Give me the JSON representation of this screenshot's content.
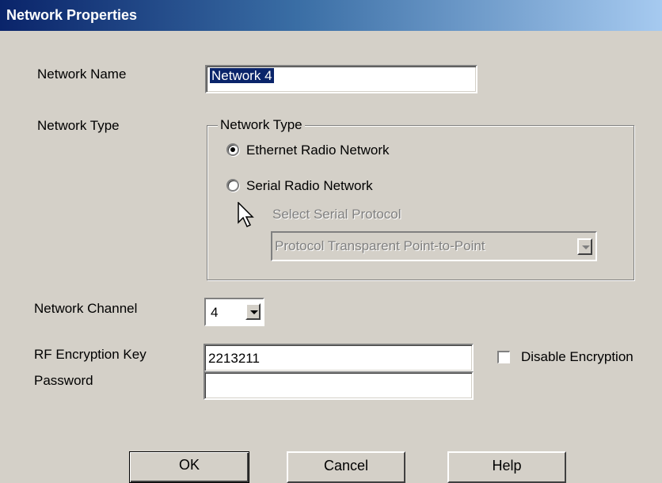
{
  "dialog": {
    "title": "Network Properties"
  },
  "network_name": {
    "label": "Network Name",
    "value": "Network 4"
  },
  "network_type": {
    "label": "Network Type",
    "group_title": "Network Type",
    "options": [
      {
        "label": "Ethernet Radio Network",
        "selected": true
      },
      {
        "label": "Serial Radio Network",
        "selected": false
      }
    ],
    "serial_protocol": {
      "label": "Select Serial Protocol",
      "value": "Protocol Transparent Point-to-Point",
      "enabled": false
    }
  },
  "network_channel": {
    "label": "Network Channel",
    "value": "4"
  },
  "rf_encryption": {
    "label": "RF Encryption Key",
    "value": "2213211"
  },
  "disable_encryption": {
    "label": "Disable Encryption",
    "checked": false
  },
  "password": {
    "label": "Password",
    "value": ""
  },
  "buttons": {
    "ok": "OK",
    "cancel": "Cancel",
    "help": "Help"
  },
  "icons": {
    "cursor": "mouse-pointer-icon",
    "dropdown_arrow": "chevron-down-icon"
  }
}
